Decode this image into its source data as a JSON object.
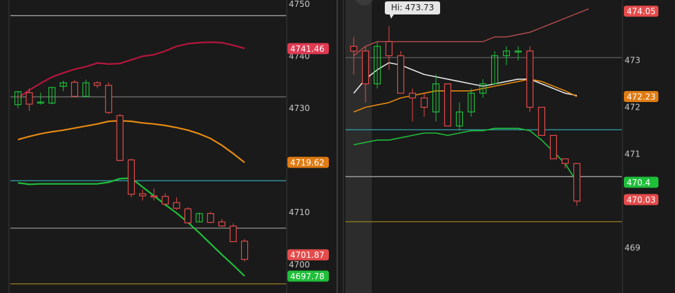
{
  "chart_data": [
    {
      "type": "candlestick",
      "ylim": [
        4696,
        4750
      ],
      "y_ticks": [
        4700,
        4710,
        4730,
        4740,
        4750
      ],
      "price_labels": [
        {
          "value": 4741.46,
          "text": "4741.46",
          "color": "#e03a52"
        },
        {
          "value": 4719.62,
          "text": "4719.62",
          "color": "#e07b12"
        },
        {
          "value": 4701.87,
          "text": "4701.87",
          "color": "#e54b4b"
        },
        {
          "value": 4697.78,
          "text": "4697.78",
          "color": "#1fbf3a"
        }
      ],
      "hlines": [
        {
          "value": 4747.8,
          "color": "#9a9a9a"
        },
        {
          "value": 4732.2,
          "color": "#6a6a6a"
        },
        {
          "value": 4716.1,
          "color": "#2f8f96"
        },
        {
          "value": 4707.0,
          "color": "#8a8a8a"
        },
        {
          "value": 4696.3,
          "color": "#8f7a1e"
        }
      ],
      "candles": [
        {
          "o": 4730.7,
          "h": 4733.3,
          "l": 4730.0,
          "c": 4733.2
        },
        {
          "o": 4733.0,
          "h": 4733.8,
          "l": 4729.5,
          "c": 4730.8
        },
        {
          "o": 4731.1,
          "h": 4733.0,
          "l": 4730.7,
          "c": 4731.2
        },
        {
          "o": 4731.0,
          "h": 4734.1,
          "l": 4730.8,
          "c": 4734.0
        },
        {
          "o": 4734.2,
          "h": 4735.3,
          "l": 4733.3,
          "c": 4734.9
        },
        {
          "o": 4735.0,
          "h": 4735.4,
          "l": 4732.3,
          "c": 4732.3
        },
        {
          "o": 4732.3,
          "h": 4735.5,
          "l": 4732.2,
          "c": 4734.9
        },
        {
          "o": 4734.9,
          "h": 4735.2,
          "l": 4733.9,
          "c": 4734.4
        },
        {
          "o": 4734.4,
          "h": 4735.0,
          "l": 4728.9,
          "c": 4729.2
        },
        {
          "o": 4728.6,
          "h": 4728.9,
          "l": 4719.9,
          "c": 4720.0
        },
        {
          "o": 4720.1,
          "h": 4720.3,
          "l": 4712.9,
          "c": 4713.5
        },
        {
          "o": 4713.6,
          "h": 4714.4,
          "l": 4712.3,
          "c": 4713.2
        },
        {
          "o": 4713.2,
          "h": 4714.6,
          "l": 4712.3,
          "c": 4713.0
        },
        {
          "o": 4713.1,
          "h": 4713.7,
          "l": 4711.2,
          "c": 4711.6
        },
        {
          "o": 4711.9,
          "h": 4712.9,
          "l": 4710.5,
          "c": 4710.8
        },
        {
          "o": 4710.7,
          "h": 4711.0,
          "l": 4707.9,
          "c": 4708.0
        },
        {
          "o": 4708.2,
          "h": 4710.0,
          "l": 4708.1,
          "c": 4709.8
        },
        {
          "o": 4709.8,
          "h": 4710.1,
          "l": 4708.0,
          "c": 4708.1
        },
        {
          "o": 4708.2,
          "h": 4708.8,
          "l": 4707.3,
          "c": 4707.4
        },
        {
          "o": 4707.4,
          "h": 4707.9,
          "l": 4704.5,
          "c": 4704.4
        },
        {
          "o": 4704.5,
          "h": 4704.9,
          "l": 4700.6,
          "c": 4701.0
        }
      ],
      "bands": [
        {
          "color": "#b7163c",
          "width": 2.2,
          "values": [
            4732.0,
            4733.5,
            4734.8,
            4736.0,
            4736.8,
            4737.5,
            4738.0,
            4738.7,
            4738.5,
            4738.6,
            4739.3,
            4740.0,
            4740.3,
            4741.0,
            4741.9,
            4742.4,
            4742.6,
            4742.7,
            4742.6,
            4742.1,
            4741.5
          ]
        },
        {
          "color": "#e58a10",
          "width": 2.2,
          "values": [
            4724.0,
            4724.6,
            4725.1,
            4725.5,
            4725.8,
            4726.2,
            4726.6,
            4727.0,
            4727.5,
            4727.6,
            4727.5,
            4727.2,
            4727.0,
            4726.7,
            4726.3,
            4725.8,
            4725.1,
            4724.2,
            4722.9,
            4721.3,
            4719.6
          ]
        },
        {
          "color": "#1fbf3a",
          "width": 2.2,
          "values": [
            4715.7,
            4715.4,
            4715.5,
            4715.5,
            4715.5,
            4715.5,
            4715.5,
            4715.5,
            4715.8,
            4716.5,
            4716.6,
            4714.9,
            4713.2,
            4711.5,
            4709.9,
            4708.1,
            4706.1,
            4704.0,
            4701.9,
            4699.9,
            4697.8
          ]
        }
      ]
    },
    {
      "type": "candlestick",
      "ylim": [
        468.2,
        474.2
      ],
      "y_ticks": [
        469,
        471,
        472,
        473
      ],
      "annotation": "Hi: 473.73",
      "price_labels": [
        {
          "value": 474.05,
          "text": "474.05",
          "color": "#e54b4b"
        },
        {
          "value": 472.23,
          "text": "472.23",
          "color": "#e07b12"
        },
        {
          "value": 470.4,
          "text": "470.4",
          "color": "#1fbf3a"
        },
        {
          "value": 470.03,
          "text": "470.03",
          "color": "#e54b4b"
        }
      ],
      "hlines": [
        {
          "value": 473.06,
          "color": "#5a5a5a"
        },
        {
          "value": 471.52,
          "color": "#2f8f96"
        },
        {
          "value": 470.52,
          "color": "#9a9a9a"
        },
        {
          "value": 469.56,
          "color": "#8f7a1e"
        }
      ],
      "candles": [
        {
          "o": 473.3,
          "h": 473.5,
          "l": 472.7,
          "c": 473.2
        },
        {
          "o": 473.2,
          "h": 473.3,
          "l": 472.1,
          "c": 472.5
        },
        {
          "o": 472.5,
          "h": 473.4,
          "l": 472.4,
          "c": 473.3
        },
        {
          "o": 473.4,
          "h": 473.73,
          "l": 472.8,
          "c": 473.1
        },
        {
          "o": 473.1,
          "h": 473.2,
          "l": 472.3,
          "c": 472.3
        },
        {
          "o": 472.3,
          "h": 472.4,
          "l": 471.7,
          "c": 472.2
        },
        {
          "o": 472.2,
          "h": 472.3,
          "l": 471.8,
          "c": 472.0
        },
        {
          "o": 471.9,
          "h": 472.7,
          "l": 471.7,
          "c": 472.5
        },
        {
          "o": 472.5,
          "h": 472.5,
          "l": 471.6,
          "c": 471.6
        },
        {
          "o": 471.6,
          "h": 472.1,
          "l": 471.5,
          "c": 471.9
        },
        {
          "o": 471.9,
          "h": 472.4,
          "l": 471.8,
          "c": 472.3
        },
        {
          "o": 472.3,
          "h": 472.6,
          "l": 472.2,
          "c": 472.5
        },
        {
          "o": 472.5,
          "h": 473.2,
          "l": 472.5,
          "c": 473.1
        },
        {
          "o": 473.1,
          "h": 473.3,
          "l": 472.9,
          "c": 473.2
        },
        {
          "o": 473.2,
          "h": 473.3,
          "l": 473.0,
          "c": 473.2
        },
        {
          "o": 473.2,
          "h": 473.3,
          "l": 471.9,
          "c": 472.0
        },
        {
          "o": 472.0,
          "h": 472.0,
          "l": 471.4,
          "c": 471.4
        },
        {
          "o": 471.4,
          "h": 471.4,
          "l": 470.9,
          "c": 470.9
        },
        {
          "o": 470.9,
          "h": 470.9,
          "l": 470.7,
          "c": 470.8
        },
        {
          "o": 470.8,
          "h": 470.8,
          "l": 469.9,
          "c": 470.0
        }
      ],
      "bands": [
        {
          "color": "#b84e4e",
          "width": 1.4,
          "values": [
            473.1,
            473.3,
            473.4,
            473.4,
            473.4,
            473.4,
            473.4,
            473.4,
            473.4,
            473.4,
            473.4,
            473.4,
            473.5,
            473.5,
            473.55,
            473.6,
            473.7,
            473.8,
            473.9,
            474.0,
            474.1
          ]
        },
        {
          "color": "#e8e8e8",
          "width": 1.6,
          "values": [
            472.3,
            472.6,
            472.8,
            472.95,
            472.9,
            472.8,
            472.7,
            472.65,
            472.6,
            472.55,
            472.5,
            472.45,
            472.5,
            472.55,
            472.6,
            472.6,
            472.5,
            472.4,
            472.3,
            472.25
          ]
        },
        {
          "color": "#e58a10",
          "width": 1.6,
          "values": [
            471.9,
            472.0,
            472.05,
            472.1,
            472.2,
            472.25,
            472.3,
            472.35,
            472.35,
            472.35,
            472.35,
            472.4,
            472.45,
            472.5,
            472.55,
            472.6,
            472.55,
            472.45,
            472.35,
            472.23
          ]
        },
        {
          "color": "#1fbf3a",
          "width": 1.6,
          "values": [
            471.2,
            471.25,
            471.3,
            471.3,
            471.35,
            471.4,
            471.45,
            471.45,
            471.4,
            471.45,
            471.5,
            471.5,
            471.55,
            471.55,
            471.55,
            471.5,
            471.3,
            471.05,
            470.8,
            470.4
          ]
        }
      ]
    }
  ]
}
